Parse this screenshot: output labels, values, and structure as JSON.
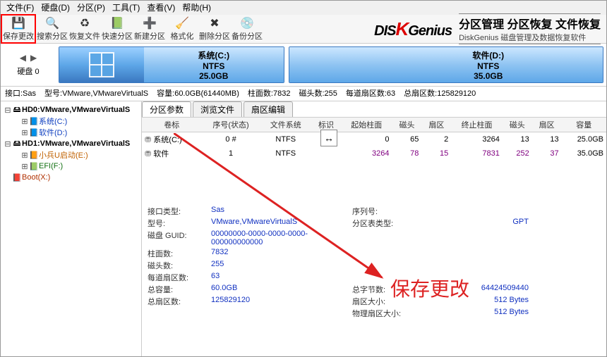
{
  "menu": [
    "文件(F)",
    "硬盘(D)",
    "分区(P)",
    "工具(T)",
    "查看(V)",
    "帮助(H)"
  ],
  "toolbar": [
    {
      "label": "保存更改",
      "icon": "💾",
      "name": "save-button",
      "hot": true
    },
    {
      "label": "搜索分区",
      "icon": "🔍",
      "name": "search-part-button"
    },
    {
      "label": "恢复文件",
      "icon": "♻",
      "name": "recover-files-button"
    },
    {
      "label": "快速分区",
      "icon": "📗",
      "name": "quick-part-button"
    },
    {
      "label": "新建分区",
      "icon": "➕",
      "name": "new-part-button"
    },
    {
      "label": "格式化",
      "icon": "🧹",
      "name": "format-button"
    },
    {
      "label": "删除分区",
      "icon": "✖",
      "name": "delete-part-button"
    },
    {
      "label": "备份分区",
      "icon": "💿",
      "name": "backup-part-button"
    }
  ],
  "branding": {
    "logo_left": "DIS",
    "logo_k": "K",
    "logo_right": "Genius",
    "line1": "分区管理 分区恢复 文件恢复",
    "line2": "DiskGenius 磁盘管理及数据恢复软件"
  },
  "overview_left": {
    "disk_label": "硬盘 0"
  },
  "partitions_bar": [
    {
      "title": "系统(C:)",
      "fs": "NTFS",
      "size": "25.0GB",
      "has_logo": true
    },
    {
      "title": "软件(D:)",
      "fs": "NTFS",
      "size": "35.0GB",
      "has_logo": false
    }
  ],
  "infoline": {
    "iface": "接口:Sas",
    "model": "型号:VMware,VMwareVirtualS",
    "cap": "容量:60.0GB(61440MB)",
    "cyl": "柱面数:7832",
    "heads": "磁头数:255",
    "spt": "每道扇区数:63",
    "sectors": "总扇区数:125829120"
  },
  "tree": {
    "hd0": "HD0:VMware,VMwareVirtualS",
    "hd0_c": "系统(C:)",
    "hd0_d": "软件(D:)",
    "hd1": "HD1:VMware,VMwareVirtualS",
    "hd1_e": "小兵U启动(E:)",
    "hd1_f": "EFI(F:)",
    "hd1_x": "Boot(X:)"
  },
  "tabs": [
    "分区参数",
    "浏览文件",
    "扇区编辑"
  ],
  "table": {
    "headers": [
      "卷标",
      "序号(状态)",
      "文件系统",
      "标识",
      "起始柱面",
      "磁头",
      "扇区",
      "终止柱面",
      "磁头",
      "扇区",
      "容量"
    ],
    "rows": [
      {
        "vol": "系统(C:)",
        "seq": "0 #",
        "fs": "NTFS",
        "flag": "",
        "sc": "0",
        "sh": "65",
        "ss": "2",
        "ec": "3264",
        "eh": "13",
        "es": "13",
        "cap": "25.0GB",
        "dark": false
      },
      {
        "vol": "软件",
        "seq": "1",
        "fs": "NTFS",
        "flag": "",
        "sc": "3264",
        "sh": "78",
        "ss": "15",
        "ec": "7831",
        "eh": "252",
        "es": "37",
        "cap": "35.0GB",
        "dark": true
      }
    ]
  },
  "drag_hint": "↔",
  "annotation": "保存更改",
  "details": [
    [
      {
        "k": "接口类型:",
        "v": "Sas"
      },
      {
        "k": "序列号:",
        "v": ""
      }
    ],
    [
      {
        "k": "型号:",
        "v": "VMware,VMwareVirtualS"
      },
      {
        "k": "分区表类型:",
        "v": "GPT"
      }
    ],
    [
      {
        "k": "磁盘 GUID:",
        "v": "00000000-0000-0000-0000-000000000000"
      },
      {
        "k": "",
        "v": ""
      }
    ],
    [
      {
        "k": "",
        "v": ""
      },
      {
        "k": "",
        "v": ""
      }
    ],
    [
      {
        "k": "柱面数:",
        "v": "7832"
      },
      {
        "k": "",
        "v": ""
      }
    ],
    [
      {
        "k": "磁头数:",
        "v": "255"
      },
      {
        "k": "",
        "v": ""
      }
    ],
    [
      {
        "k": "每道扇区数:",
        "v": "63"
      },
      {
        "k": "",
        "v": ""
      }
    ],
    [
      {
        "k": "总容量:",
        "v": "60.0GB"
      },
      {
        "k": "总字节数:",
        "v": "64424509440"
      }
    ],
    [
      {
        "k": "总扇区数:",
        "v": "125829120"
      },
      {
        "k": "扇区大小:",
        "v": "512 Bytes"
      }
    ],
    [
      {
        "k": "",
        "v": ""
      },
      {
        "k": "物理扇区大小:",
        "v": "512 Bytes"
      }
    ]
  ]
}
